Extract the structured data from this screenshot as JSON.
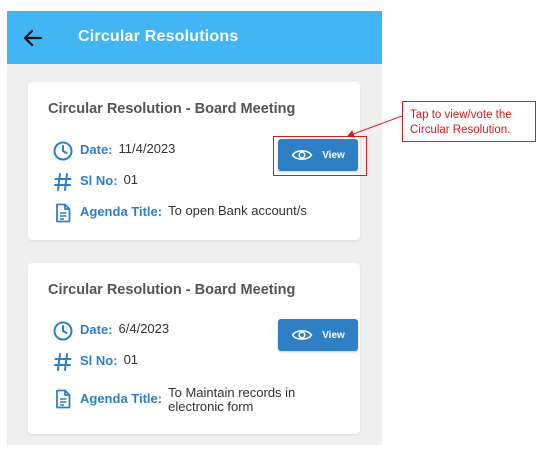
{
  "appbar": {
    "title": "Circular Resolutions",
    "back_icon": "back-arrow-icon",
    "color": "#42b6f5"
  },
  "resolutions": [
    {
      "title": "Circular Resolution - Board Meeting",
      "date_label": "Date:",
      "date": "11/4/2023",
      "sl_label": "Sl No:",
      "sl_no": "01",
      "agenda_label": "Agenda Title:",
      "agenda": "To open Bank account/s",
      "view_label": "View"
    },
    {
      "title": "Circular Resolution - Board Meeting",
      "date_label": "Date:",
      "date": "6/4/2023",
      "sl_label": "Sl No:",
      "sl_no": "01",
      "agenda_label": "Agenda Title:",
      "agenda": "To Maintain records in electronic form",
      "view_label": "View"
    }
  ],
  "annotation": {
    "text": "Tap to view/vote the Circular Resolution.",
    "color": "#d81b1b"
  },
  "colors": {
    "accent": "#2f7fc4",
    "background": "#efefef"
  }
}
